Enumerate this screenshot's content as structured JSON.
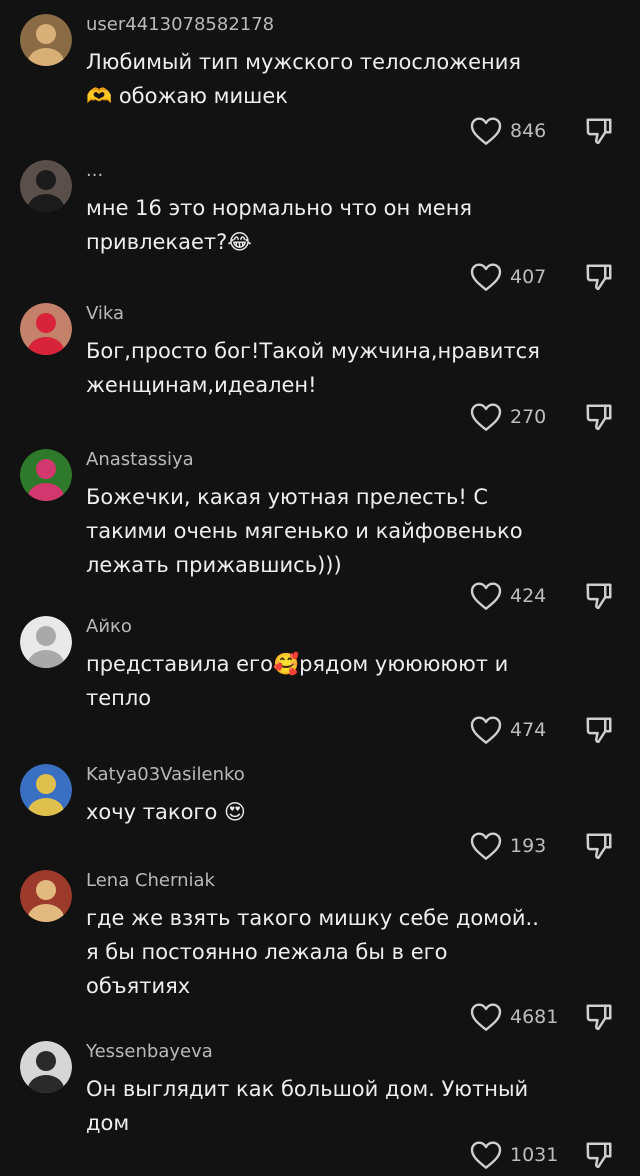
{
  "comments": [
    {
      "username": "user4413078582178",
      "text": "Любимый тип мужского телосложения\n🫶 обожаю мишек",
      "likes": "846",
      "avatar": {
        "bg": "#8a6b45",
        "fg": "#d8b077",
        "icon": "cat-avatar"
      }
    },
    {
      "username": "...",
      "text": "мне 16 это нормально что он меня\nпривлекает?😂",
      "likes": "407",
      "avatar": {
        "bg": "#5b4f4c",
        "fg": "#1c1c1c",
        "icon": "people-photo-avatar"
      }
    },
    {
      "username": "Vika",
      "text": "Бог,просто бог!Такой мужчина,нравится\nженщинам,идеален!",
      "likes": "270",
      "avatar": {
        "bg": "#c4826a",
        "fg": "#d8233a",
        "icon": "girl-photo-avatar"
      }
    },
    {
      "username": "Anastassiya",
      "text": "Божечки, какая уютная прелесть! С\nтакими очень мягенько и кайфовенько\nлежать прижавшись)))",
      "likes": "424",
      "avatar": {
        "bg": "#2f7a2a",
        "fg": "#d2386e",
        "icon": "flower-avatar"
      }
    },
    {
      "username": "Айко",
      "text": "представила его🥰рядом уююююют и\nтепло",
      "likes": "474",
      "avatar": {
        "bg": "#e9e9e9",
        "fg": "#a9a9a9",
        "icon": "drawing-avatar"
      }
    },
    {
      "username": "Katya03Vasilenko",
      "text": "хочу такого 😍",
      "likes": "193",
      "avatar": {
        "bg": "#3a6fc2",
        "fg": "#e0c04d",
        "icon": "girl-photo-avatar"
      }
    },
    {
      "username": "Lena Cherniak",
      "text": "где же взять такого мишку себе домой..\nя бы постоянно лежала бы в его\nобъятиях",
      "likes": "4681",
      "avatar": {
        "bg": "#9c3a2b",
        "fg": "#e2b97e",
        "icon": "woman-mask-avatar"
      }
    },
    {
      "username": "Yessenbayeva",
      "text": "Он выглядит как большой дом. Уютный\nдом",
      "likes": "1031",
      "avatar": {
        "bg": "#d6d6d6",
        "fg": "#2a2a2a",
        "icon": "woman-photo-avatar"
      }
    }
  ]
}
